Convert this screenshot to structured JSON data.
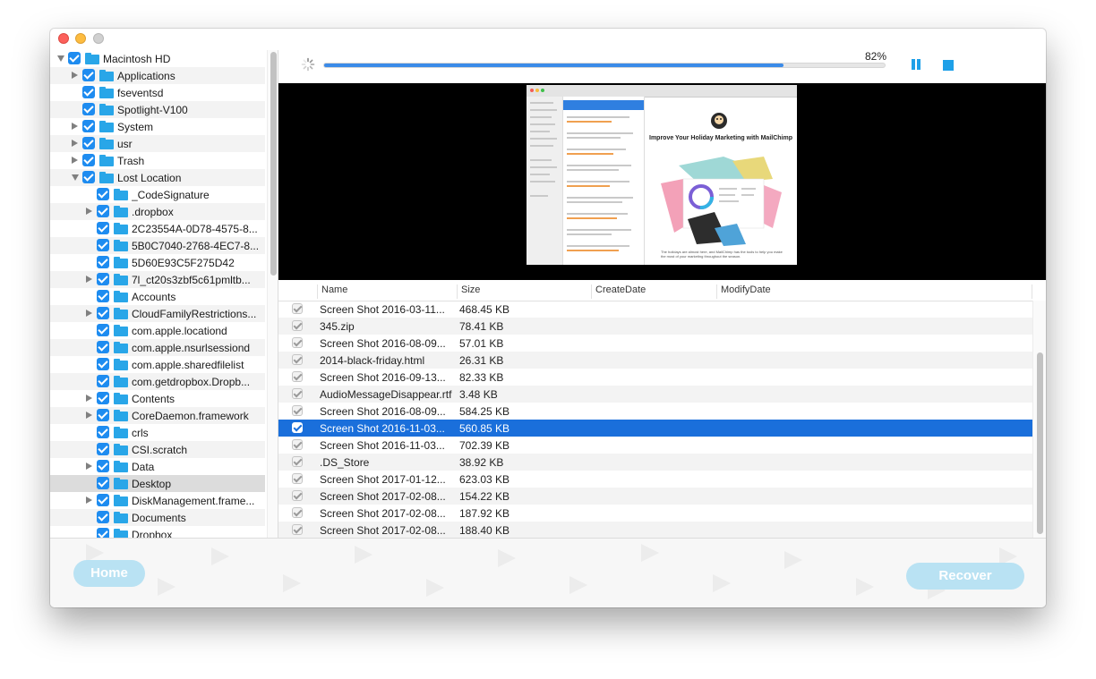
{
  "tree": {
    "items": [
      {
        "label": "Macintosh HD",
        "depth": 0,
        "expander": "down"
      },
      {
        "label": "Applications",
        "depth": 1,
        "expander": "right"
      },
      {
        "label": "fseventsd",
        "depth": 1,
        "expander": "none"
      },
      {
        "label": "Spotlight-V100",
        "depth": 1,
        "expander": "none"
      },
      {
        "label": "System",
        "depth": 1,
        "expander": "right"
      },
      {
        "label": "usr",
        "depth": 1,
        "expander": "right"
      },
      {
        "label": "Trash",
        "depth": 1,
        "expander": "right"
      },
      {
        "label": "Lost Location",
        "depth": 1,
        "expander": "down"
      },
      {
        "label": "_CodeSignature",
        "depth": 2,
        "expander": "none"
      },
      {
        "label": ".dropbox",
        "depth": 2,
        "expander": "right"
      },
      {
        "label": "2C23554A-0D78-4575-8...",
        "depth": 2,
        "expander": "none"
      },
      {
        "label": "5B0C7040-2768-4EC7-8...",
        "depth": 2,
        "expander": "none"
      },
      {
        "label": "5D60E93C5F275D42",
        "depth": 2,
        "expander": "none"
      },
      {
        "label": "7l_ct20s3zbf5c61pmltb...",
        "depth": 2,
        "expander": "right"
      },
      {
        "label": "Accounts",
        "depth": 2,
        "expander": "none"
      },
      {
        "label": "CloudFamilyRestrictions...",
        "depth": 2,
        "expander": "right"
      },
      {
        "label": "com.apple.locationd",
        "depth": 2,
        "expander": "none"
      },
      {
        "label": "com.apple.nsurlsessiond",
        "depth": 2,
        "expander": "none"
      },
      {
        "label": "com.apple.sharedfilelist",
        "depth": 2,
        "expander": "none"
      },
      {
        "label": "com.getdropbox.Dropb...",
        "depth": 2,
        "expander": "none"
      },
      {
        "label": "Contents",
        "depth": 2,
        "expander": "right"
      },
      {
        "label": "CoreDaemon.framework",
        "depth": 2,
        "expander": "right"
      },
      {
        "label": "crls",
        "depth": 2,
        "expander": "none"
      },
      {
        "label": "CSI.scratch",
        "depth": 2,
        "expander": "none"
      },
      {
        "label": "Data",
        "depth": 2,
        "expander": "right"
      },
      {
        "label": "Desktop",
        "depth": 2,
        "expander": "none",
        "selected": true
      },
      {
        "label": "DiskManagement.frame...",
        "depth": 2,
        "expander": "right"
      },
      {
        "label": "Documents",
        "depth": 2,
        "expander": "none"
      },
      {
        "label": "Dropbox",
        "depth": 2,
        "expander": "none"
      }
    ]
  },
  "scan": {
    "progress_percent": 82,
    "progress_label": "82%",
    "pause_icon": "pause-icon",
    "stop_icon": "stop-icon"
  },
  "preview": {
    "headline": "Improve Your Holiday Marketing with MailChimp",
    "footer_text": "The holidays are almost here, and MailChimp has the tools to help you make the most of your marketing throughout the season."
  },
  "table": {
    "columns": [
      "Name",
      "Size",
      "CreateDate",
      "ModifyDate"
    ],
    "rows": [
      {
        "name": "Screen Shot 2016-03-11...",
        "size": "468.45 KB"
      },
      {
        "name": "345.zip",
        "size": "78.41 KB"
      },
      {
        "name": "Screen Shot 2016-08-09...",
        "size": "57.01 KB"
      },
      {
        "name": "2014-black-friday.html",
        "size": "26.31 KB"
      },
      {
        "name": "Screen Shot 2016-09-13...",
        "size": "82.33 KB"
      },
      {
        "name": "AudioMessageDisappear.rtf",
        "size": "3.48 KB"
      },
      {
        "name": "Screen Shot 2016-08-09...",
        "size": "584.25 KB"
      },
      {
        "name": "Screen Shot 2016-11-03...",
        "size": "560.85 KB",
        "selected": true
      },
      {
        "name": "Screen Shot 2016-11-03...",
        "size": "702.39 KB"
      },
      {
        "name": ".DS_Store",
        "size": "38.92 KB"
      },
      {
        "name": "Screen Shot 2017-01-12...",
        "size": "623.03 KB"
      },
      {
        "name": "Screen Shot 2017-02-08...",
        "size": "154.22 KB"
      },
      {
        "name": "Screen Shot 2017-02-08...",
        "size": "187.92 KB"
      },
      {
        "name": "Screen Shot 2017-02-08...",
        "size": "188.40 KB"
      }
    ]
  },
  "footer": {
    "home_label": "Home",
    "recover_label": "Recover"
  },
  "colors": {
    "accent": "#1e8cf0",
    "selection": "#1a6fdb",
    "button": "#b9e2f3",
    "folder": "#29a6e8"
  }
}
